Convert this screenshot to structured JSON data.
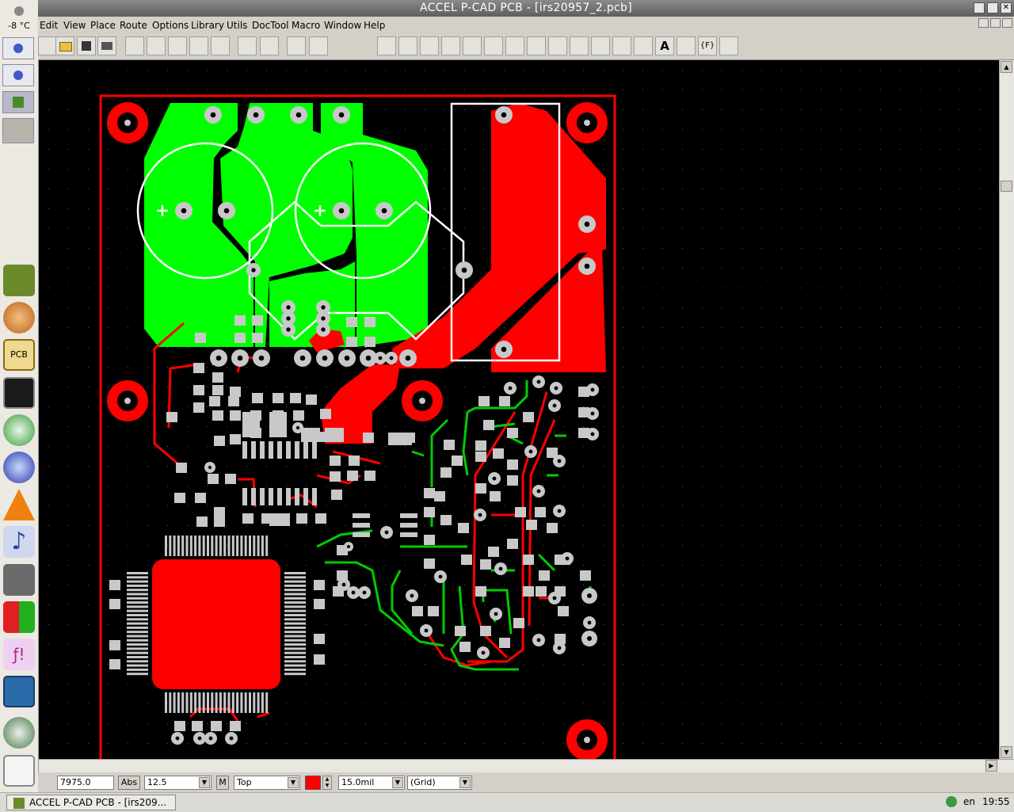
{
  "window": {
    "title": "ACCEL P-CAD PCB - [irs20957_2.pcb]"
  },
  "dock": {
    "temperature": "-8 °C",
    "apps": [
      "pcad-icon",
      "shell-icon",
      "pcb-icon",
      "terminal-icon",
      "network-icon",
      "browser-icon",
      "vlc-icon",
      "music-icon",
      "tools-icon",
      "cube-icon",
      "formula-icon",
      "monitor-icon",
      "media-icon",
      "mobile-icon"
    ]
  },
  "menu": {
    "items": [
      "Edit",
      "View",
      "Place",
      "Route",
      "Options",
      "Library",
      "Utils",
      "DocTool",
      "Macro",
      "Window",
      "Help"
    ]
  },
  "status": {
    "coord": "7975.0",
    "abs_label": "Abs",
    "grid_value": "12.5",
    "m_label": "M",
    "layer": "Top",
    "layer_color": "#ff0000",
    "line_width": "15.0mil",
    "snap": "(Grid)"
  },
  "taskbar": {
    "task_label": "ACCEL P-CAD PCB - [irs209...",
    "lang": "en",
    "time": "19:55"
  },
  "colors": {
    "top_copper": "#ff0000",
    "bottom_copper": "#00ff00",
    "silk": "#ffffff",
    "pad": "#c8c8c8"
  }
}
